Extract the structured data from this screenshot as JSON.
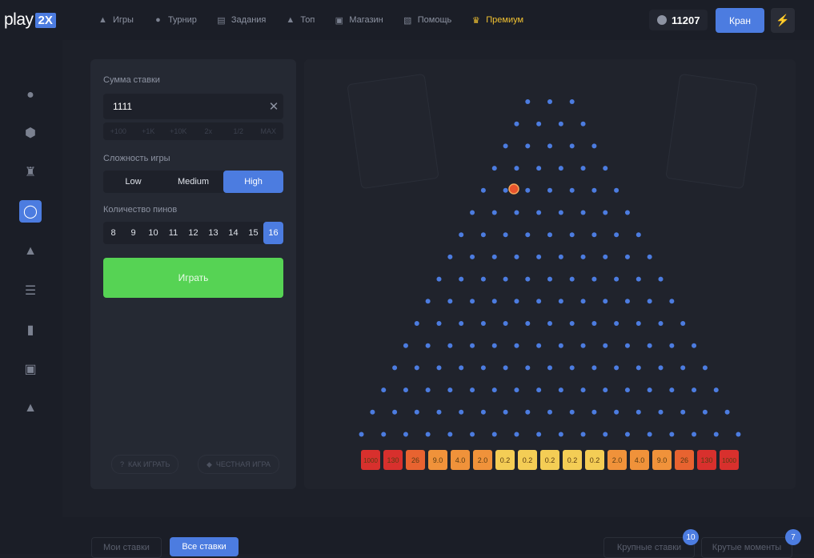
{
  "logo": {
    "play": "play",
    "badge": "2X"
  },
  "nav": [
    {
      "label": "Игры",
      "icon": "gamepad-icon"
    },
    {
      "label": "Турнир",
      "icon": "medal-icon"
    },
    {
      "label": "Задания",
      "icon": "tasks-icon"
    },
    {
      "label": "Топ",
      "icon": "trophy-icon"
    },
    {
      "label": "Магазин",
      "icon": "basket-icon"
    },
    {
      "label": "Помощь",
      "icon": "help-icon"
    },
    {
      "label": "Премиум",
      "icon": "crown-icon"
    }
  ],
  "balance": "11207",
  "kran_label": "Кран",
  "sidebar": [
    {
      "name": "bomb-icon"
    },
    {
      "name": "dice-icon"
    },
    {
      "name": "tower-icon"
    },
    {
      "name": "plinko-icon"
    },
    {
      "name": "crash-icon"
    },
    {
      "name": "ladder-icon"
    },
    {
      "name": "chart-bars-icon"
    },
    {
      "name": "slot-x50-icon"
    },
    {
      "name": "coinflip-icon"
    }
  ],
  "panel": {
    "bet_label": "Сумма ставки",
    "bet_value": "1111",
    "quick": [
      "+100",
      "+1K",
      "+10K",
      "2x",
      "1/2",
      "MAX"
    ],
    "difficulty_label": "Сложность игры",
    "difficulty": [
      "Low",
      "Medium",
      "High"
    ],
    "difficulty_selected": "High",
    "pins_label": "Количество пинов",
    "pins": [
      "8",
      "9",
      "10",
      "11",
      "12",
      "13",
      "14",
      "15",
      "16"
    ],
    "pins_selected": "16",
    "play_label": "Играть",
    "how_to_play": "КАК ИГРАТЬ",
    "fair_game": "ЧЕСТНАЯ ИГРА"
  },
  "board": {
    "rows": 16,
    "multipliers": [
      "1000",
      "130",
      "26",
      "9.0",
      "4.0",
      "2.0",
      "0.2",
      "0.2",
      "0.2",
      "0.2",
      "0.2",
      "2.0",
      "4.0",
      "9.0",
      "26",
      "130",
      "1000"
    ],
    "colors": {
      "pin": "#4c7ce0",
      "high": "#d8302d",
      "mid": "#e86330",
      "orange": "#f0923a",
      "low": "#f4cd55",
      "ball": "#e8542d"
    }
  },
  "tabs": {
    "my_bets": "Мои ставки",
    "all_bets": "Все ставки",
    "big_bets": "Крупные ставки",
    "big_bets_count": "10",
    "cool_moments": "Крутые моменты",
    "cool_moments_count": "7"
  }
}
